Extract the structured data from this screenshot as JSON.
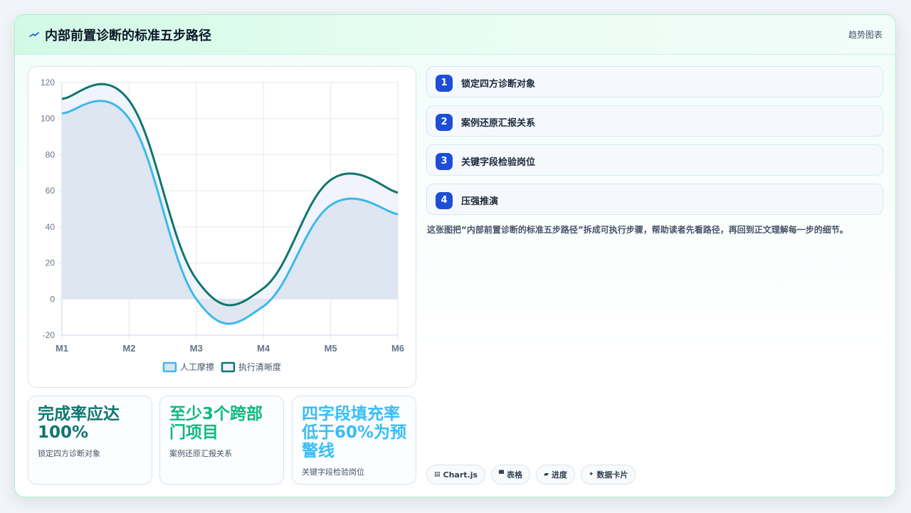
{
  "header": {
    "title": "内部前置诊断的标准五步路径",
    "tag": "趋势图表"
  },
  "steps": [
    {
      "num": "1",
      "label": "锁定四方诊断对象"
    },
    {
      "num": "2",
      "label": "案例还原汇报关系"
    },
    {
      "num": "3",
      "label": "关键字段检验岗位"
    },
    {
      "num": "4",
      "label": "压强推演"
    }
  ],
  "description": "这张图把“内部前置诊断的标准五步路径”拆成可执行步骤，帮助读者先看路径，再回到正文理解每一步的细节。",
  "stats": [
    {
      "big": "完成率应达100%",
      "small": "锁定四方诊断对象",
      "color": "#0f766e"
    },
    {
      "big": "至少3个跨部门项目",
      "small": "案例还原汇报关系",
      "color": "#10b981"
    },
    {
      "big": "四字段填充率低于60%为预警线",
      "small": "关键字段检验岗位",
      "color": "#38bdf8"
    }
  ],
  "chips": [
    {
      "icon": "chart-icon",
      "glyph": "▤",
      "label": "Chart.js"
    },
    {
      "icon": "table-icon",
      "glyph": "▀",
      "label": "表格"
    },
    {
      "icon": "progress-icon",
      "glyph": "▰",
      "label": "进度"
    },
    {
      "icon": "sparkle-icon",
      "glyph": "✦",
      "label": "数据卡片"
    }
  ],
  "chart_data": {
    "type": "line",
    "categories": [
      "M1",
      "M2",
      "M3",
      "M4",
      "M5",
      "M6"
    ],
    "series": [
      {
        "name": "人工摩擦",
        "values": [
          103,
          100,
          0,
          -4,
          52,
          47
        ],
        "color": "#3bb9ec",
        "fill": "#dbe3ef",
        "filled": true
      },
      {
        "name": "执行清晰度",
        "values": [
          111,
          110,
          11,
          6,
          66,
          59
        ],
        "color": "#0f766e",
        "fill": "#eef2fc",
        "filled": true
      }
    ],
    "ylim": [
      -20,
      120
    ],
    "yticks": [
      -20,
      0,
      20,
      40,
      60,
      80,
      100,
      120
    ],
    "grid": true,
    "legend": "bottom"
  }
}
